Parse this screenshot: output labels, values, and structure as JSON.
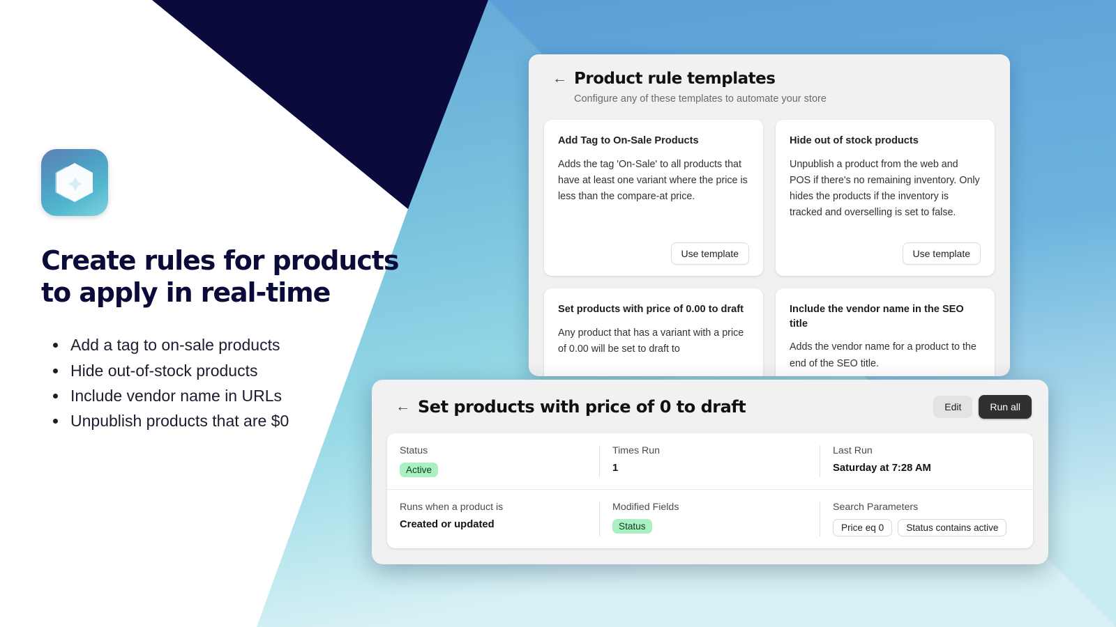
{
  "theme": {
    "navy": "#0b0b3a",
    "sky_blue": "#5b9bd5",
    "cyan": "#8ed8e8",
    "white": "#ffffff",
    "panel_gray": "#f1f1f1",
    "badge_green": "#aaf0c0",
    "dark_button": "#303030"
  },
  "left": {
    "app_icon_name": "hexagon-sparkle-icon",
    "headline": "Create rules for products to apply in real-time",
    "bullets": [
      "Add a tag to on-sale products",
      "Hide out-of-stock products",
      "Include vendor name in URLs",
      "Unpublish products that are $0"
    ]
  },
  "templates_panel": {
    "back_icon": "←",
    "title": "Product rule templates",
    "subtitle": "Configure any of these templates to automate your store",
    "cards": [
      {
        "name": "Add Tag to On-Sale Products",
        "description": "Adds the tag 'On-Sale' to all products that have at least one variant where the price is less than the compare-at price.",
        "button": "Use template"
      },
      {
        "name": "Hide out of stock products",
        "description": "Unpublish a product from the web and POS if there's no remaining inventory. Only hides the products if the inventory is tracked and overselling is set to false.",
        "button": "Use template"
      },
      {
        "name": "Set products with price of 0.00 to draft",
        "description": "Any product that has a variant with a price of 0.00 will be set to draft to"
      },
      {
        "name": "Include the vendor name in the SEO title",
        "description": "Adds the vendor name for a product to the end of the SEO title."
      }
    ]
  },
  "detail_panel": {
    "back_icon": "←",
    "title": "Set products with price of 0 to draft",
    "edit_label": "Edit",
    "run_all_label": "Run all",
    "rows": [
      {
        "status_label": "Status",
        "status_value": "Active",
        "times_run_label": "Times Run",
        "times_run_value": "1",
        "last_run_label": "Last Run",
        "last_run_value": "Saturday at 7:28 AM"
      },
      {
        "trigger_label": "Runs when a product is",
        "trigger_value": "Created or updated",
        "modified_label": "Modified Fields",
        "modified_value": "Status",
        "search_label": "Search Parameters",
        "search_chips": [
          "Price eq 0",
          "Status contains active"
        ]
      }
    ]
  }
}
